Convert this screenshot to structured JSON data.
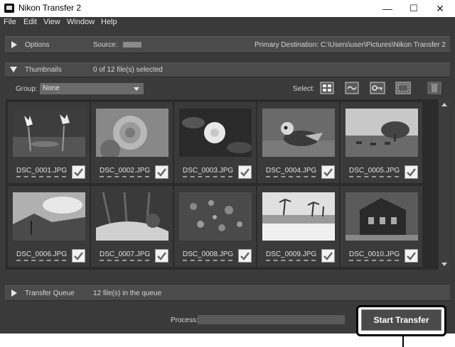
{
  "window": {
    "title": "Nikon Transfer 2",
    "minimize": "—",
    "maximize": "☐",
    "close": "✕"
  },
  "menu": [
    "File",
    "Edit",
    "View",
    "Window",
    "Help"
  ],
  "options": {
    "label": "Options",
    "source_label": "Source:",
    "destination": "Primary Destination: C:\\Users\\user\\Pictures\\Nikon Transfer 2"
  },
  "thumbnails": {
    "label": "Thumbnails",
    "selection_status": "0 of 12 file(s) selected",
    "group_label": "Group:",
    "group_value": "None",
    "select_label": "Select:",
    "items": [
      {
        "name": "DSC_0001.JPG",
        "checked": true
      },
      {
        "name": "DSC_0002.JPG",
        "checked": true
      },
      {
        "name": "DSC_0003.JPG",
        "checked": true
      },
      {
        "name": "DSC_0004.JPG",
        "checked": true
      },
      {
        "name": "DSC_0005.JPG",
        "checked": true
      },
      {
        "name": "DSC_0006.JPG",
        "checked": true
      },
      {
        "name": "DSC_0007.JPG",
        "checked": true
      },
      {
        "name": "DSC_0008.JPG",
        "checked": true
      },
      {
        "name": "DSC_0009.JPG",
        "checked": true
      },
      {
        "name": "DSC_0010.JPG",
        "checked": true
      }
    ]
  },
  "queue": {
    "label": "Transfer Queue",
    "status": "12 file(s) in the queue"
  },
  "process": {
    "label": "Process:"
  },
  "start_button": {
    "label": "Start Transfer"
  },
  "icons": [
    "app-icon",
    "expand-triangle-icon",
    "collapse-triangle-icon",
    "select-grid-icon",
    "select-wave-icon",
    "select-key-icon",
    "select-frame-icon",
    "trash-icon",
    "checkmark-icon",
    "scroll-up-icon",
    "scroll-down-icon"
  ]
}
